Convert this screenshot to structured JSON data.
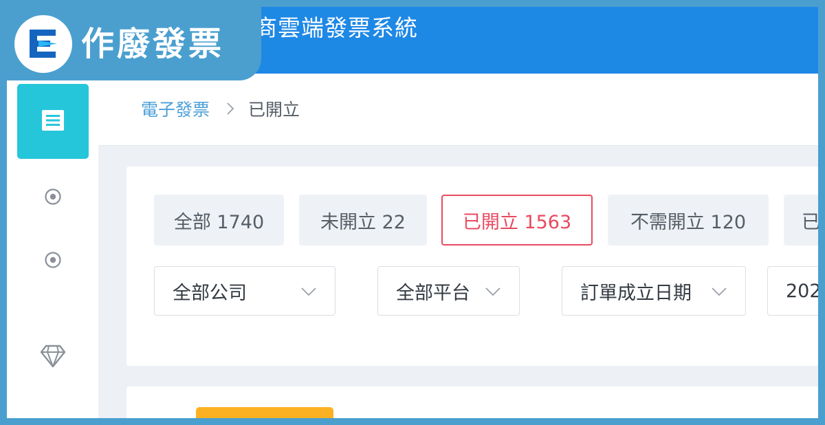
{
  "badge": {
    "logo_icon": "e-logo-icon",
    "text": "作廢發票"
  },
  "header": {
    "app_title": "商雲端發票系統"
  },
  "sidebar": {
    "items": [
      {
        "icon": "receipt-icon",
        "active": true
      },
      {
        "icon": "target-icon",
        "active": false
      },
      {
        "icon": "target-icon",
        "active": false
      },
      {
        "icon": "diamond-icon",
        "active": false
      }
    ]
  },
  "breadcrumb": {
    "parent": "電子發票",
    "separator_icon": "chevron-right-icon",
    "current": "已開立"
  },
  "tabs": [
    {
      "label": "全部 1740",
      "active": false
    },
    {
      "label": "未開立 22",
      "active": false
    },
    {
      "label": "已開立 1563",
      "active": true
    },
    {
      "label": "不需開立 120",
      "active": false
    },
    {
      "label": "已",
      "active": false
    }
  ],
  "filters": {
    "company": "全部公司",
    "platform": "全部平台",
    "date_type": "訂單成立日期",
    "date_value": "202",
    "chevron_icon": "chevron-down-icon"
  },
  "colors": {
    "topbar": "#1e88e5",
    "badge": "#4a9fcf",
    "sidebar_active": "#26c6da",
    "tab_active": "#e8495f",
    "link": "#4a9fd8",
    "accent_button": "#fbb122"
  }
}
